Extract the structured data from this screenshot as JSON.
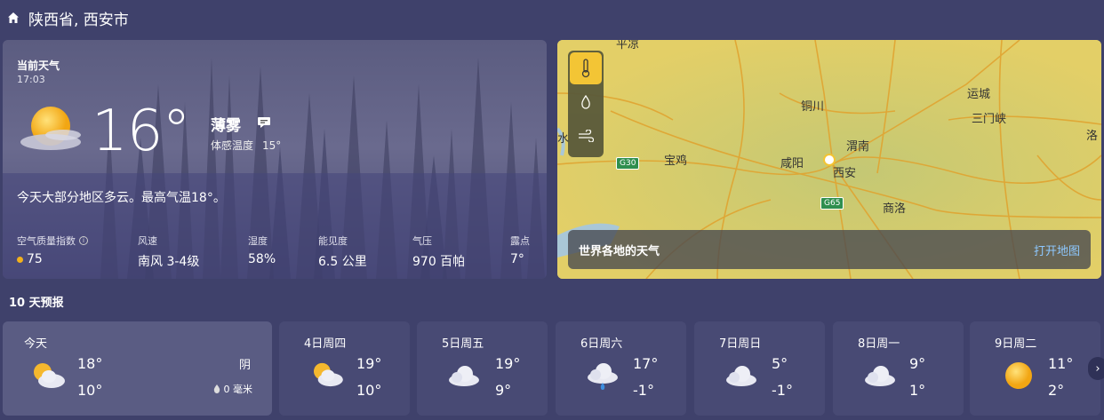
{
  "header": {
    "location": "陕西省, 西安市"
  },
  "current": {
    "title": "当前天气",
    "time": "17:03",
    "temperature": "16°",
    "condition": "薄雾",
    "feels_label": "体感温度",
    "feels_value": "15°",
    "summary": "今天大部分地区多云。最高气温18°。",
    "stats": [
      {
        "label": "空气质量指数",
        "value": "75",
        "dot": "#f2b11b"
      },
      {
        "label": "风速",
        "value": "南风 3-4级"
      },
      {
        "label": "湿度",
        "value": "58%"
      },
      {
        "label": "能见度",
        "value": "6.5 公里"
      },
      {
        "label": "气压",
        "value": "970 百帕"
      },
      {
        "label": "露点",
        "value": "7°"
      }
    ]
  },
  "map": {
    "title": "世界各地的天气",
    "link": "打开地图",
    "cities": [
      "铜川",
      "渭南",
      "咸阳",
      "西安",
      "宝鸡",
      "商洛",
      "运城",
      "三门峡",
      "洛",
      "平凉",
      "水"
    ],
    "badges": [
      "G30",
      "G65"
    ]
  },
  "forecast": {
    "title": "10 天预报",
    "days": [
      {
        "day": "今天",
        "hi": "18°",
        "lo": "10°",
        "cond": "阴",
        "rain": "0 毫米",
        "icon": "partly-cloudy-icon"
      },
      {
        "day": "4日周四",
        "hi": "19°",
        "lo": "10°",
        "icon": "partly-cloudy-icon"
      },
      {
        "day": "5日周五",
        "hi": "19°",
        "lo": "9°",
        "icon": "cloud-icon"
      },
      {
        "day": "6日周六",
        "hi": "17°",
        "lo": "-1°",
        "icon": "rain-cloud-icon"
      },
      {
        "day": "7日周日",
        "hi": "5°",
        "lo": "-1°",
        "icon": "cloud-icon"
      },
      {
        "day": "8日周一",
        "hi": "9°",
        "lo": "1°",
        "icon": "cloud-icon"
      },
      {
        "day": "9日周二",
        "hi": "11°",
        "lo": "2°",
        "icon": "sun-icon"
      }
    ]
  }
}
